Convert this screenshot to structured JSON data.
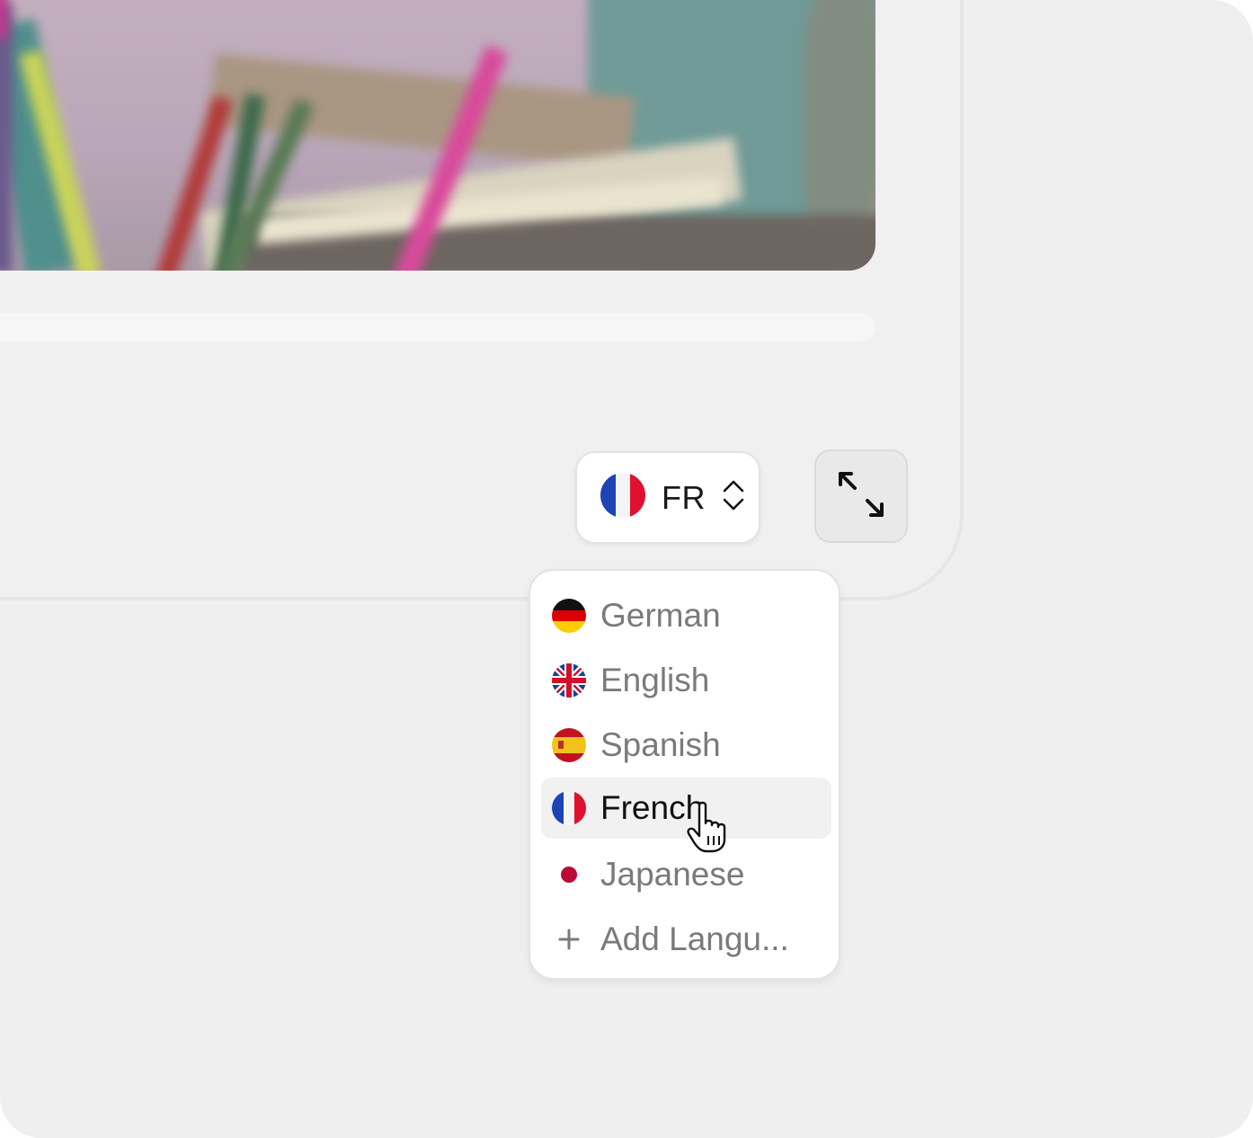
{
  "language_selector": {
    "current_code": "FR",
    "current_flag": "flag-france-icon"
  },
  "menu": {
    "items": [
      {
        "label": "German",
        "icon": "flag-germany-icon"
      },
      {
        "label": "English",
        "icon": "flag-uk-icon"
      },
      {
        "label": "Spanish",
        "icon": "flag-spain-icon"
      },
      {
        "label": "French",
        "icon": "flag-france-icon",
        "selected": true
      },
      {
        "label": "Japanese",
        "icon": "flag-japan-icon"
      },
      {
        "label": "Add Langu...",
        "icon": "plus-icon"
      }
    ]
  },
  "colors": {
    "background": "#efefef",
    "menu_background": "#ffffff",
    "selected_row": "#f1f1f1",
    "text_muted": "#7a7a7a",
    "text_active": "#111111"
  }
}
